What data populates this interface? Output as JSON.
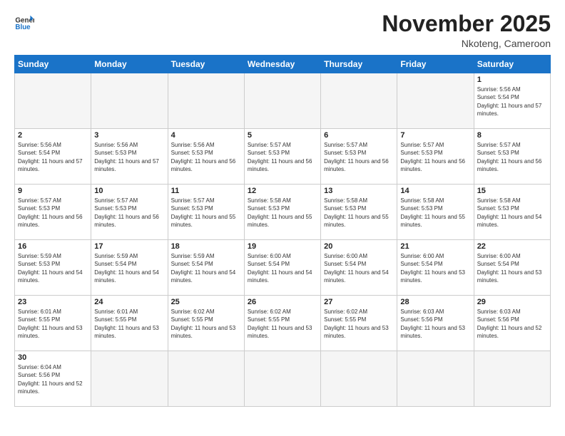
{
  "header": {
    "logo_general": "General",
    "logo_blue": "Blue",
    "month_title": "November 2025",
    "location": "Nkoteng, Cameroon"
  },
  "weekdays": [
    "Sunday",
    "Monday",
    "Tuesday",
    "Wednesday",
    "Thursday",
    "Friday",
    "Saturday"
  ],
  "weeks": [
    [
      {
        "day": "",
        "empty": true
      },
      {
        "day": "",
        "empty": true
      },
      {
        "day": "",
        "empty": true
      },
      {
        "day": "",
        "empty": true
      },
      {
        "day": "",
        "empty": true
      },
      {
        "day": "",
        "empty": true
      },
      {
        "day": "1",
        "sunrise": "5:56 AM",
        "sunset": "5:54 PM",
        "daylight": "11 hours and 57 minutes."
      }
    ],
    [
      {
        "day": "2",
        "sunrise": "5:56 AM",
        "sunset": "5:54 PM",
        "daylight": "11 hours and 57 minutes."
      },
      {
        "day": "3",
        "sunrise": "5:56 AM",
        "sunset": "5:53 PM",
        "daylight": "11 hours and 57 minutes."
      },
      {
        "day": "4",
        "sunrise": "5:56 AM",
        "sunset": "5:53 PM",
        "daylight": "11 hours and 56 minutes."
      },
      {
        "day": "5",
        "sunrise": "5:57 AM",
        "sunset": "5:53 PM",
        "daylight": "11 hours and 56 minutes."
      },
      {
        "day": "6",
        "sunrise": "5:57 AM",
        "sunset": "5:53 PM",
        "daylight": "11 hours and 56 minutes."
      },
      {
        "day": "7",
        "sunrise": "5:57 AM",
        "sunset": "5:53 PM",
        "daylight": "11 hours and 56 minutes."
      },
      {
        "day": "8",
        "sunrise": "5:57 AM",
        "sunset": "5:53 PM",
        "daylight": "11 hours and 56 minutes."
      }
    ],
    [
      {
        "day": "9",
        "sunrise": "5:57 AM",
        "sunset": "5:53 PM",
        "daylight": "11 hours and 56 minutes."
      },
      {
        "day": "10",
        "sunrise": "5:57 AM",
        "sunset": "5:53 PM",
        "daylight": "11 hours and 56 minutes."
      },
      {
        "day": "11",
        "sunrise": "5:57 AM",
        "sunset": "5:53 PM",
        "daylight": "11 hours and 55 minutes."
      },
      {
        "day": "12",
        "sunrise": "5:58 AM",
        "sunset": "5:53 PM",
        "daylight": "11 hours and 55 minutes."
      },
      {
        "day": "13",
        "sunrise": "5:58 AM",
        "sunset": "5:53 PM",
        "daylight": "11 hours and 55 minutes."
      },
      {
        "day": "14",
        "sunrise": "5:58 AM",
        "sunset": "5:53 PM",
        "daylight": "11 hours and 55 minutes."
      },
      {
        "day": "15",
        "sunrise": "5:58 AM",
        "sunset": "5:53 PM",
        "daylight": "11 hours and 54 minutes."
      }
    ],
    [
      {
        "day": "16",
        "sunrise": "5:59 AM",
        "sunset": "5:53 PM",
        "daylight": "11 hours and 54 minutes."
      },
      {
        "day": "17",
        "sunrise": "5:59 AM",
        "sunset": "5:54 PM",
        "daylight": "11 hours and 54 minutes."
      },
      {
        "day": "18",
        "sunrise": "5:59 AM",
        "sunset": "5:54 PM",
        "daylight": "11 hours and 54 minutes."
      },
      {
        "day": "19",
        "sunrise": "6:00 AM",
        "sunset": "5:54 PM",
        "daylight": "11 hours and 54 minutes."
      },
      {
        "day": "20",
        "sunrise": "6:00 AM",
        "sunset": "5:54 PM",
        "daylight": "11 hours and 54 minutes."
      },
      {
        "day": "21",
        "sunrise": "6:00 AM",
        "sunset": "5:54 PM",
        "daylight": "11 hours and 53 minutes."
      },
      {
        "day": "22",
        "sunrise": "6:00 AM",
        "sunset": "5:54 PM",
        "daylight": "11 hours and 53 minutes."
      }
    ],
    [
      {
        "day": "23",
        "sunrise": "6:01 AM",
        "sunset": "5:55 PM",
        "daylight": "11 hours and 53 minutes."
      },
      {
        "day": "24",
        "sunrise": "6:01 AM",
        "sunset": "5:55 PM",
        "daylight": "11 hours and 53 minutes."
      },
      {
        "day": "25",
        "sunrise": "6:02 AM",
        "sunset": "5:55 PM",
        "daylight": "11 hours and 53 minutes."
      },
      {
        "day": "26",
        "sunrise": "6:02 AM",
        "sunset": "5:55 PM",
        "daylight": "11 hours and 53 minutes."
      },
      {
        "day": "27",
        "sunrise": "6:02 AM",
        "sunset": "5:55 PM",
        "daylight": "11 hours and 53 minutes."
      },
      {
        "day": "28",
        "sunrise": "6:03 AM",
        "sunset": "5:56 PM",
        "daylight": "11 hours and 53 minutes."
      },
      {
        "day": "29",
        "sunrise": "6:03 AM",
        "sunset": "5:56 PM",
        "daylight": "11 hours and 52 minutes."
      }
    ],
    [
      {
        "day": "30",
        "sunrise": "6:04 AM",
        "sunset": "5:56 PM",
        "daylight": "11 hours and 52 minutes."
      },
      {
        "day": "",
        "empty": true
      },
      {
        "day": "",
        "empty": true
      },
      {
        "day": "",
        "empty": true
      },
      {
        "day": "",
        "empty": true
      },
      {
        "day": "",
        "empty": true
      },
      {
        "day": "",
        "empty": true
      }
    ]
  ]
}
